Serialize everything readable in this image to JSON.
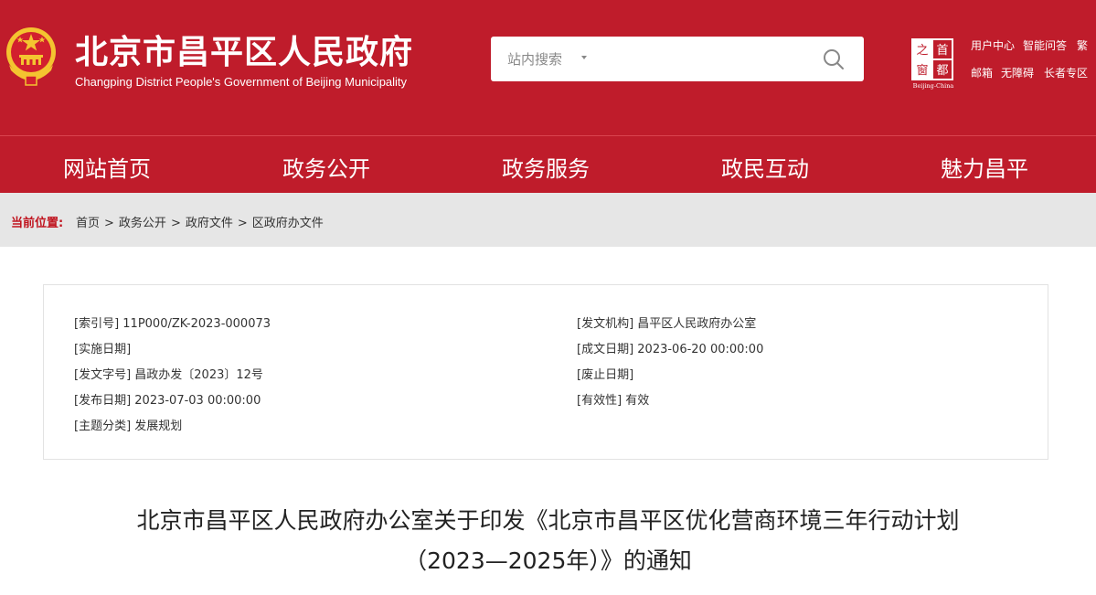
{
  "header": {
    "title": "北京市昌平区人民政府",
    "subtitle": "Changping District People's Government of Beijing Municipality",
    "emblem_icon": "national-emblem-icon",
    "seal": {
      "chars": [
        "首",
        "都",
        "之",
        "窗"
      ],
      "caption": "Beijing-China"
    },
    "links_row1": [
      "用户中心",
      "智能问答",
      "繁"
    ],
    "links_row2": [
      "邮箱",
      "无障碍",
      "长者专区"
    ]
  },
  "search": {
    "scope": "站内搜索",
    "placeholder": "",
    "icon": "search-icon"
  },
  "nav": {
    "items": [
      "网站首页",
      "政务公开",
      "政务服务",
      "政民互动",
      "魅力昌平"
    ]
  },
  "breadcrumb": {
    "label": "当前位置:",
    "items": [
      "首页",
      "政务公开",
      "政府文件",
      "区政府办文件"
    ]
  },
  "meta": {
    "left": [
      "[索引号] 11P000/ZK-2023-000073",
      "[实施日期]",
      "[发文字号] 昌政办发〔2023〕12号",
      "[发布日期] 2023-07-03 00:00:00",
      "[主题分类] 发展规划"
    ],
    "right": [
      "[发文机构] 昌平区人民政府办公室",
      "[成文日期] 2023-06-20 00:00:00",
      "[废止日期]",
      "[有效性] 有效"
    ]
  },
  "document": {
    "title_line1": "北京市昌平区人民政府办公室关于印发《北京市昌平区优化营商环境三年行动计划",
    "title_line2": "（2023—2025年）》的通知"
  },
  "colors": {
    "brand_red": "#bf1c2b",
    "gold": "#f4c430",
    "breadcrumb_bg": "#e6e6e6"
  }
}
